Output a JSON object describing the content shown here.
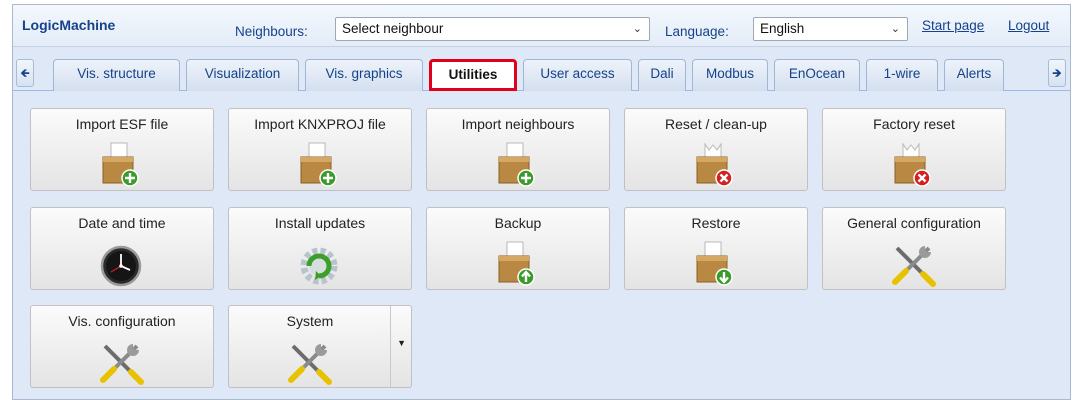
{
  "header": {
    "app_name": "LogicMachine",
    "neighbours_label": "Neighbours:",
    "neighbours_value": "Select neighbour",
    "language_label": "Language:",
    "language_value": "English",
    "start_page_link": "Start page",
    "logout_link": "Logout"
  },
  "tabs": [
    {
      "label": "Vis. structure"
    },
    {
      "label": "Visualization"
    },
    {
      "label": "Vis. graphics"
    },
    {
      "label": "Utilities",
      "active": true
    },
    {
      "label": "User access"
    },
    {
      "label": "Dali"
    },
    {
      "label": "Modbus"
    },
    {
      "label": "EnOcean"
    },
    {
      "label": "1-wire"
    },
    {
      "label": "Alerts"
    }
  ],
  "tiles": [
    {
      "label": "Import ESF file",
      "icon": "box-add-icon"
    },
    {
      "label": "Import KNXPROJ file",
      "icon": "box-add-icon"
    },
    {
      "label": "Import neighbours",
      "icon": "box-add-icon"
    },
    {
      "label": "Reset / clean-up",
      "icon": "box-remove-icon"
    },
    {
      "label": "Factory reset",
      "icon": "box-remove-icon"
    },
    {
      "label": "Date and time",
      "icon": "clock-icon"
    },
    {
      "label": "Install updates",
      "icon": "update-gear-icon"
    },
    {
      "label": "Backup",
      "icon": "box-upload-icon"
    },
    {
      "label": "Restore",
      "icon": "box-download-icon"
    },
    {
      "label": "General configuration",
      "icon": "tools-icon"
    },
    {
      "label": "Vis. configuration",
      "icon": "tools-icon"
    },
    {
      "label": "System",
      "icon": "tools-icon"
    }
  ],
  "colors": {
    "accent_blue": "#15428b",
    "active_tab_outline": "#e0001a",
    "panel_bg": "#dfe8f6"
  }
}
